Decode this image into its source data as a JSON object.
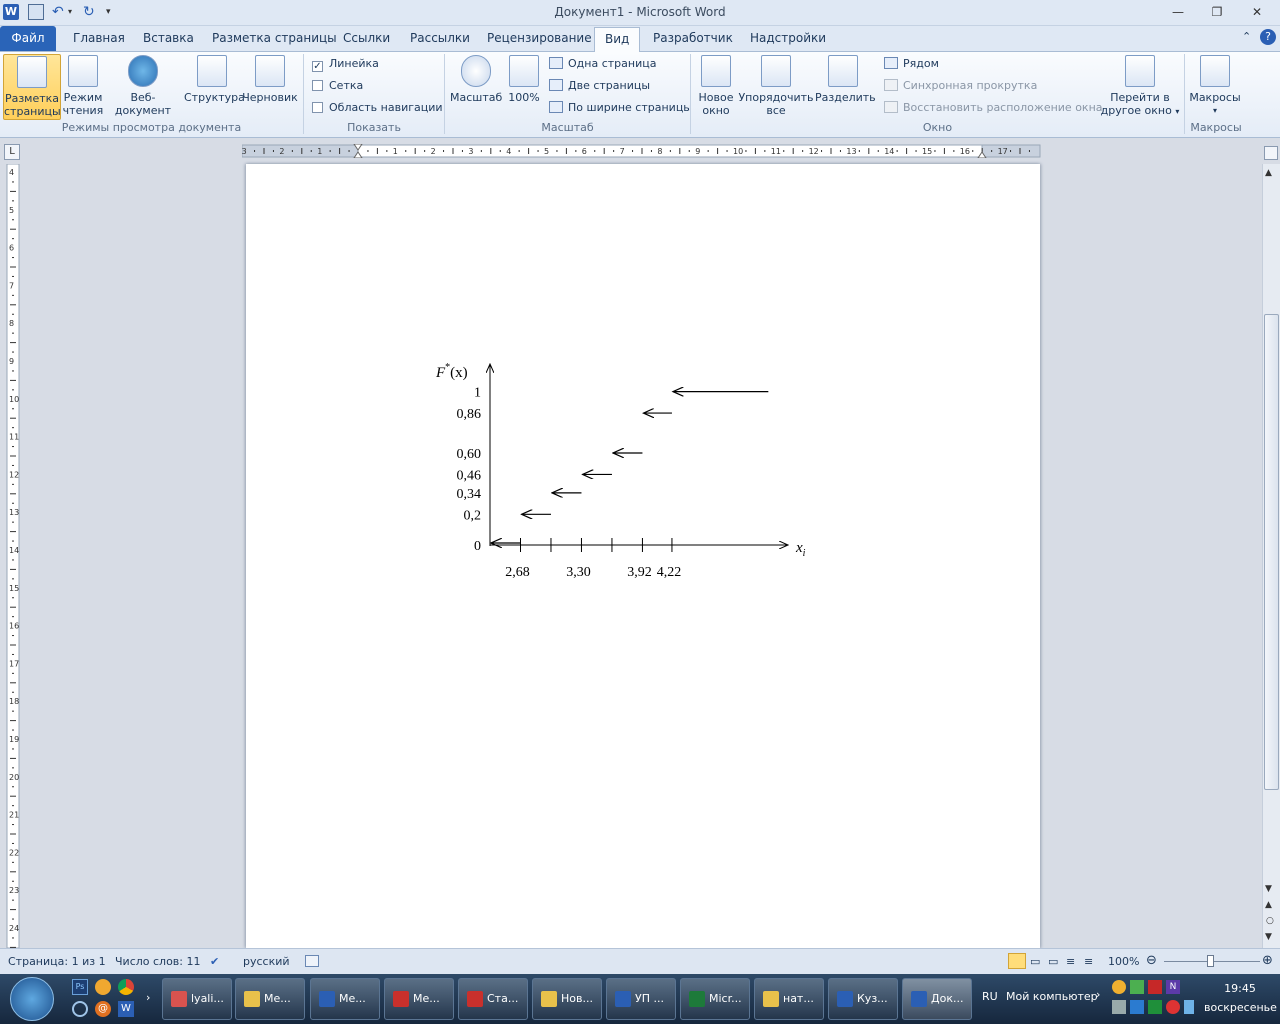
{
  "window": {
    "title": "Документ1  -  Microsoft Word",
    "minimize": "—",
    "maximize": "❐",
    "close": "✕"
  },
  "tabs": [
    {
      "label": "Файл"
    },
    {
      "label": "Главная"
    },
    {
      "label": "Вставка"
    },
    {
      "label": "Разметка страницы"
    },
    {
      "label": "Ссылки"
    },
    {
      "label": "Рассылки"
    },
    {
      "label": "Рецензирование"
    },
    {
      "label": "Вид"
    },
    {
      "label": "Разработчик"
    },
    {
      "label": "Надстройки"
    }
  ],
  "ribbon": {
    "views": {
      "label": "Режимы просмотра документа",
      "buttons": [
        {
          "label1": "Разметка",
          "label2": "страницы"
        },
        {
          "label1": "Режим",
          "label2": "чтения"
        },
        {
          "label1": "Веб-документ",
          "label2": ""
        },
        {
          "label1": "Структура",
          "label2": ""
        },
        {
          "label1": "Черновик",
          "label2": ""
        }
      ]
    },
    "show": {
      "label": "Показать",
      "ruler": "Линейка",
      "grid": "Сетка",
      "nav": "Область навигации",
      "ruler_checked": true,
      "grid_checked": false,
      "nav_checked": false
    },
    "zoom": {
      "label": "Масштаб",
      "zoom_btn": "Масштаб",
      "hundred_btn": "100%",
      "one_page": "Одна страница",
      "two_pages": "Две страницы",
      "page_width": "По ширине страницы"
    },
    "window": {
      "label": "Окно",
      "new_window1": "Новое",
      "new_window2": "окно",
      "arrange1": "Упорядочить",
      "arrange2": "все",
      "split": "Разделить",
      "side_by_side": "Рядом",
      "sync_scroll": "Синхронная прокрутка",
      "reset_pos": "Восстановить расположение окна",
      "switch1": "Перейти в",
      "switch2": "другое окно"
    },
    "macros": {
      "label": "Макросы",
      "button": "Макросы"
    }
  },
  "document": {
    "chart_data": {
      "type": "line",
      "title": "",
      "ylabel_F": "F",
      "ylabel_star": "*",
      "ylabel_arg": "(x)",
      "xlabel_x": "x",
      "xlabel_sub": "i",
      "ytick_labels": [
        "1",
        "0,86",
        "0,60",
        "0,46",
        "0,34",
        "0,2",
        "0"
      ],
      "xtick_labels": [
        "2,68",
        "3,30",
        "3,92",
        "4,22"
      ],
      "steps": [
        {
          "x_from": 2.37,
          "x_to": 2.68,
          "y": 0
        },
        {
          "x_from": 2.68,
          "x_to": 2.99,
          "y": 0.2
        },
        {
          "x_from": 2.99,
          "x_to": 3.3,
          "y": 0.34
        },
        {
          "x_from": 3.3,
          "x_to": 3.61,
          "y": 0.46
        },
        {
          "x_from": 3.61,
          "x_to": 3.92,
          "y": 0.6
        },
        {
          "x_from": 3.92,
          "x_to": 4.22,
          "y": 0.86
        },
        {
          "x_from": 4.22,
          "x_to": 5.2,
          "y": 1
        }
      ],
      "xlim": [
        2.37,
        5.4
      ],
      "ylim": [
        0,
        1.18
      ]
    }
  },
  "status": {
    "page": "Страница: 1 из 1",
    "words": "Число слов: 11",
    "language": "русский",
    "zoom": "100%"
  },
  "taskbar": {
    "items": [
      {
        "label": "lyali...",
        "color": "#d9534f"
      },
      {
        "label": "Ме...",
        "color": "#e8c14b"
      },
      {
        "label": "Ме...",
        "color": "#2b5fb4"
      },
      {
        "label": "Ме...",
        "color": "#c9302c"
      },
      {
        "label": "Ста...",
        "color": "#c9302c"
      },
      {
        "label": "Нов...",
        "color": "#e8c14b"
      },
      {
        "label": "УП ...",
        "color": "#2b5fb4"
      },
      {
        "label": "Micr...",
        "color": "#1d7a3a"
      },
      {
        "label": "нат...",
        "color": "#e8c14b"
      },
      {
        "label": "Куз...",
        "color": "#2b5fb4"
      },
      {
        "label": "Док...",
        "color": "#2b5fb4"
      }
    ],
    "lang": "RU",
    "my_computer": "Мой компьютер",
    "time": "19:45",
    "day": "воскресенье"
  }
}
